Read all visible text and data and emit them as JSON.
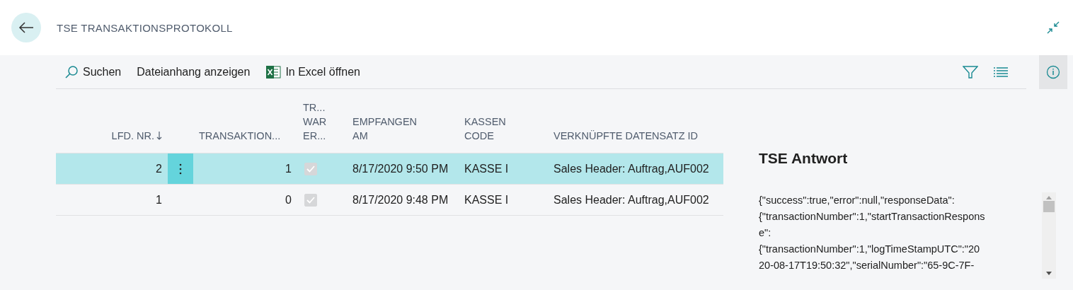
{
  "header": {
    "title": "TSE TRANSAKTIONSPROTOKOLL"
  },
  "actions": [
    {
      "label": "Suchen",
      "kind": "search"
    },
    {
      "label": "Dateianhang anzeigen",
      "kind": "plain"
    },
    {
      "label": "In Excel öffnen",
      "kind": "excel"
    }
  ],
  "table": {
    "columns": [
      {
        "lines": [
          "LFD. NR."
        ],
        "sorted": true
      },
      {
        "lines": [
          "TRANSAKTION..."
        ],
        "sorted": false
      },
      {
        "lines": [
          "TR...",
          "WAR",
          "ER..."
        ],
        "sorted": false
      },
      {
        "lines": [
          "EMPFANGEN",
          "AM"
        ],
        "sorted": false
      },
      {
        "lines": [
          "KASSEN",
          "CODE"
        ],
        "sorted": false
      },
      {
        "lines": [
          "VERKNÜPFTE DATENSATZ ID"
        ],
        "sorted": false
      }
    ],
    "rows": [
      {
        "lfd_nr": "2",
        "transaktion": "1",
        "checked": true,
        "empfangen_am": "8/17/2020 9:50 PM",
        "kassen_code": "KASSE I",
        "datensatz_id": "Sales Header: Auftrag,AUF002",
        "selected": true
      },
      {
        "lfd_nr": "1",
        "transaktion": "0",
        "checked": true,
        "empfangen_am": "8/17/2020 9:48 PM",
        "kassen_code": "KASSE I",
        "datensatz_id": "Sales Header: Auftrag,AUF002",
        "selected": false
      }
    ]
  },
  "factbox": {
    "title": "TSE Antwort",
    "lines": [
      "{\"success\":true,\"error\":null,\"responseData\":",
      "{\"transactionNumber\":1,\"startTransactionRespons",
      "e\":",
      "{\"transactionNumber\":1,\"logTimeStampUTC\":\"20",
      "20-08-17T19:50:32\",\"serialNumber\":\"65-9C-7F-"
    ]
  }
}
